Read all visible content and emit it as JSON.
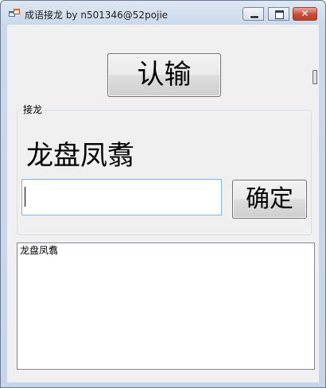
{
  "window": {
    "title": "成语接龙 by n501346@52pojie",
    "minimize_label": "",
    "maximize_label": "",
    "close_label": "✕",
    "icon": "app-window-icon"
  },
  "actions": {
    "surrender_label": "认输",
    "confirm_label": "确定"
  },
  "group": {
    "legend": "接龙",
    "current_idiom": "龙盘凤翥"
  },
  "input": {
    "value": "",
    "placeholder": ""
  },
  "history": {
    "lines": [
      "龙盘凤翥"
    ]
  },
  "colors": {
    "input_border": "#7eb4ea",
    "client_bg": "#f0f0f0",
    "close_button": "#c74a33"
  }
}
